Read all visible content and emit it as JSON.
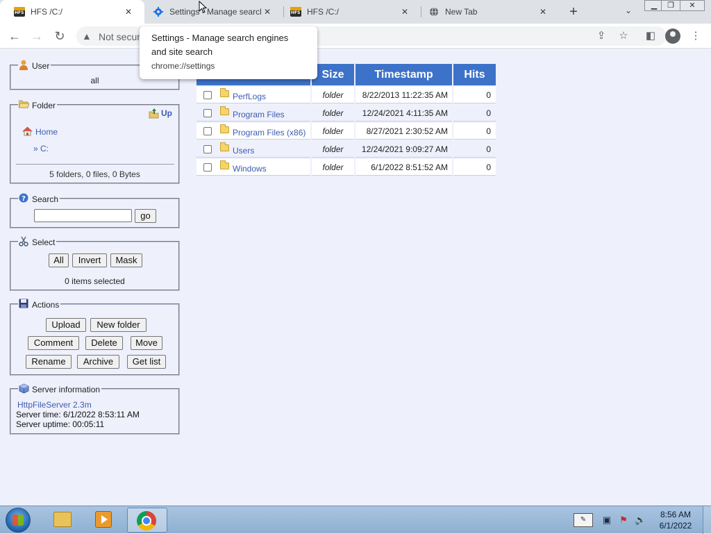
{
  "browser": {
    "tabs": [
      {
        "title": "HFS /C:/",
        "icon": "hfs-icon",
        "active": true
      },
      {
        "title": "Settings - Manage search",
        "icon": "gear-icon",
        "active": false
      },
      {
        "title": "HFS /C:/",
        "icon": "hfs-icon",
        "active": false
      },
      {
        "title": "New Tab",
        "icon": "globe-icon",
        "active": false
      }
    ],
    "address": {
      "security_label": "Not secur"
    },
    "tooltip": {
      "title": "Settings - Manage search engines and site search",
      "url": "chrome://settings"
    }
  },
  "sidebar": {
    "user": {
      "legend": "User",
      "value": "all"
    },
    "folder": {
      "legend": "Folder",
      "up_label": "Up",
      "home_label": "Home",
      "path_label": "» C:",
      "summary": "5 folders, 0 files, 0 Bytes"
    },
    "search": {
      "legend": "Search",
      "go_label": "go",
      "value": ""
    },
    "select": {
      "legend": "Select",
      "buttons": {
        "all": "All",
        "invert": "Invert",
        "mask": "Mask"
      },
      "status": "0 items selected"
    },
    "actions": {
      "legend": "Actions",
      "buttons": {
        "upload": "Upload",
        "new_folder": "New folder",
        "comment": "Comment",
        "delete": "Delete",
        "move": "Move",
        "rename": "Rename",
        "archive": "Archive",
        "get_list": "Get list"
      }
    },
    "server": {
      "legend": "Server information",
      "software": "HttpFileServer 2.3m",
      "time": "Server time: 6/1/2022 8:53:11 AM",
      "uptime": "Server uptime: 00:05:11"
    }
  },
  "files": {
    "headers": {
      "size": "Size",
      "timestamp": "Timestamp",
      "hits": "Hits"
    },
    "rows": [
      {
        "name": "PerfLogs",
        "size": "folder",
        "timestamp": "8/22/2013 11:22:35 AM",
        "hits": "0"
      },
      {
        "name": "Program Files",
        "size": "folder",
        "timestamp": "12/24/2021 4:11:35 AM",
        "hits": "0"
      },
      {
        "name": "Program Files (x86)",
        "size": "folder",
        "timestamp": "8/27/2021 2:30:52 AM",
        "hits": "0"
      },
      {
        "name": "Users",
        "size": "folder",
        "timestamp": "12/24/2021 9:09:27 AM",
        "hits": "0"
      },
      {
        "name": "Windows",
        "size": "folder",
        "timestamp": "6/1/2022 8:51:52 AM",
        "hits": "0"
      }
    ]
  },
  "taskbar": {
    "clock": {
      "time": "8:56 AM",
      "date": "6/1/2022"
    }
  },
  "colors": {
    "page_background": "#eef0fb",
    "table_header": "#3d72c9",
    "link": "#3d5cb0"
  }
}
